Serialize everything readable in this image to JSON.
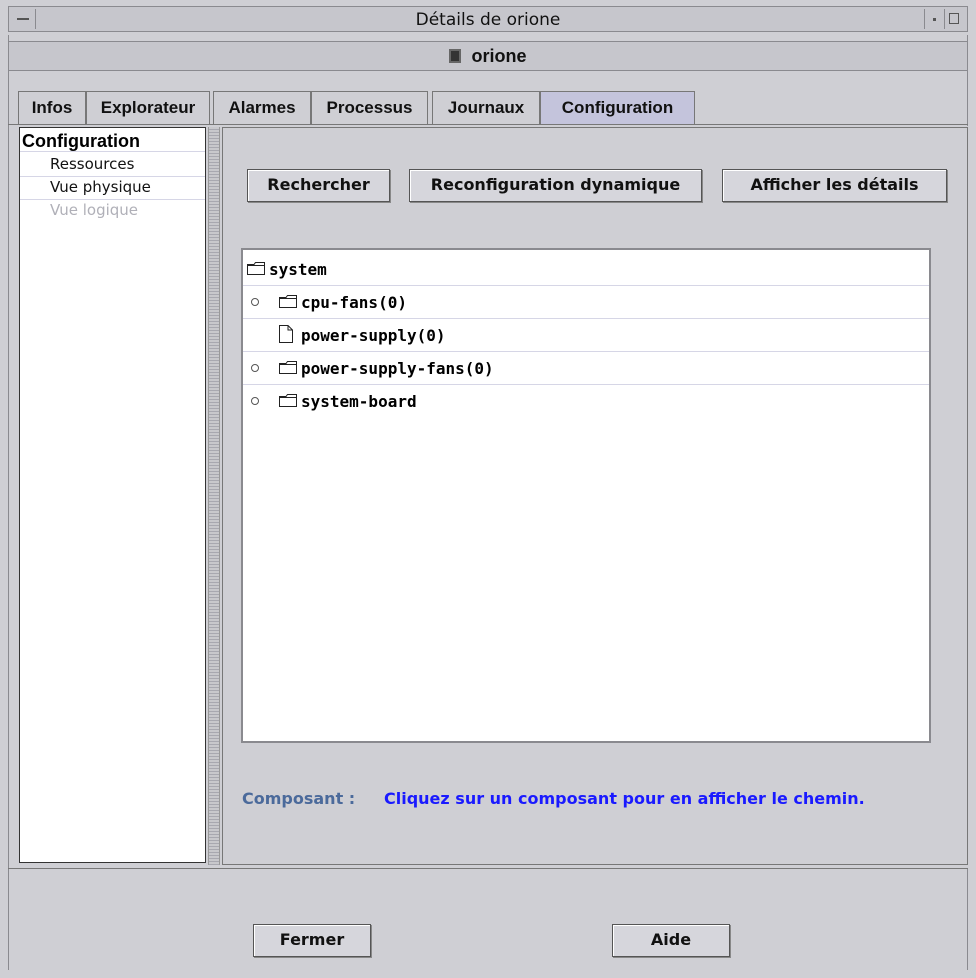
{
  "window": {
    "title": "Détails de orione"
  },
  "host": {
    "name": "orione",
    "icon": "host-icon"
  },
  "tabs": [
    {
      "label": "Infos"
    },
    {
      "label": "Explorateur"
    },
    {
      "label": "Alarmes"
    },
    {
      "label": "Processus"
    },
    {
      "label": "Journaux"
    },
    {
      "label": "Configuration",
      "active": true
    }
  ],
  "sidebar": {
    "heading": "Configuration",
    "items": [
      {
        "label": "Ressources",
        "state": "normal"
      },
      {
        "label": "Vue physique",
        "state": "normal"
      },
      {
        "label": "Vue logique",
        "state": "disabled"
      }
    ]
  },
  "toolbar": {
    "search_label": "Rechercher",
    "reconfigure_label": "Reconfiguration dynamique",
    "details_label": "Afficher les détails"
  },
  "tree": {
    "nodes": [
      {
        "label": "system",
        "icon": "folder-icon",
        "expander": false
      },
      {
        "label": "cpu-fans(0)",
        "icon": "folder-icon",
        "expander": true
      },
      {
        "label": "power-supply(0)",
        "icon": "file-icon",
        "expander": false
      },
      {
        "label": "power-supply-fans(0)",
        "icon": "folder-icon",
        "expander": true
      },
      {
        "label": "system-board",
        "icon": "folder-icon",
        "expander": true
      }
    ]
  },
  "component": {
    "label": "Composant :",
    "hint": "Cliquez sur un composant pour en afficher le chemin."
  },
  "footer": {
    "close_label": "Fermer",
    "help_label": "Aide"
  },
  "colors": {
    "background": "#cfcfd4",
    "active_tab": "#c4c4dc",
    "path_label": "#4b6a9b",
    "path_value": "#1a1aff",
    "disabled_text": "#b0b0b8"
  }
}
